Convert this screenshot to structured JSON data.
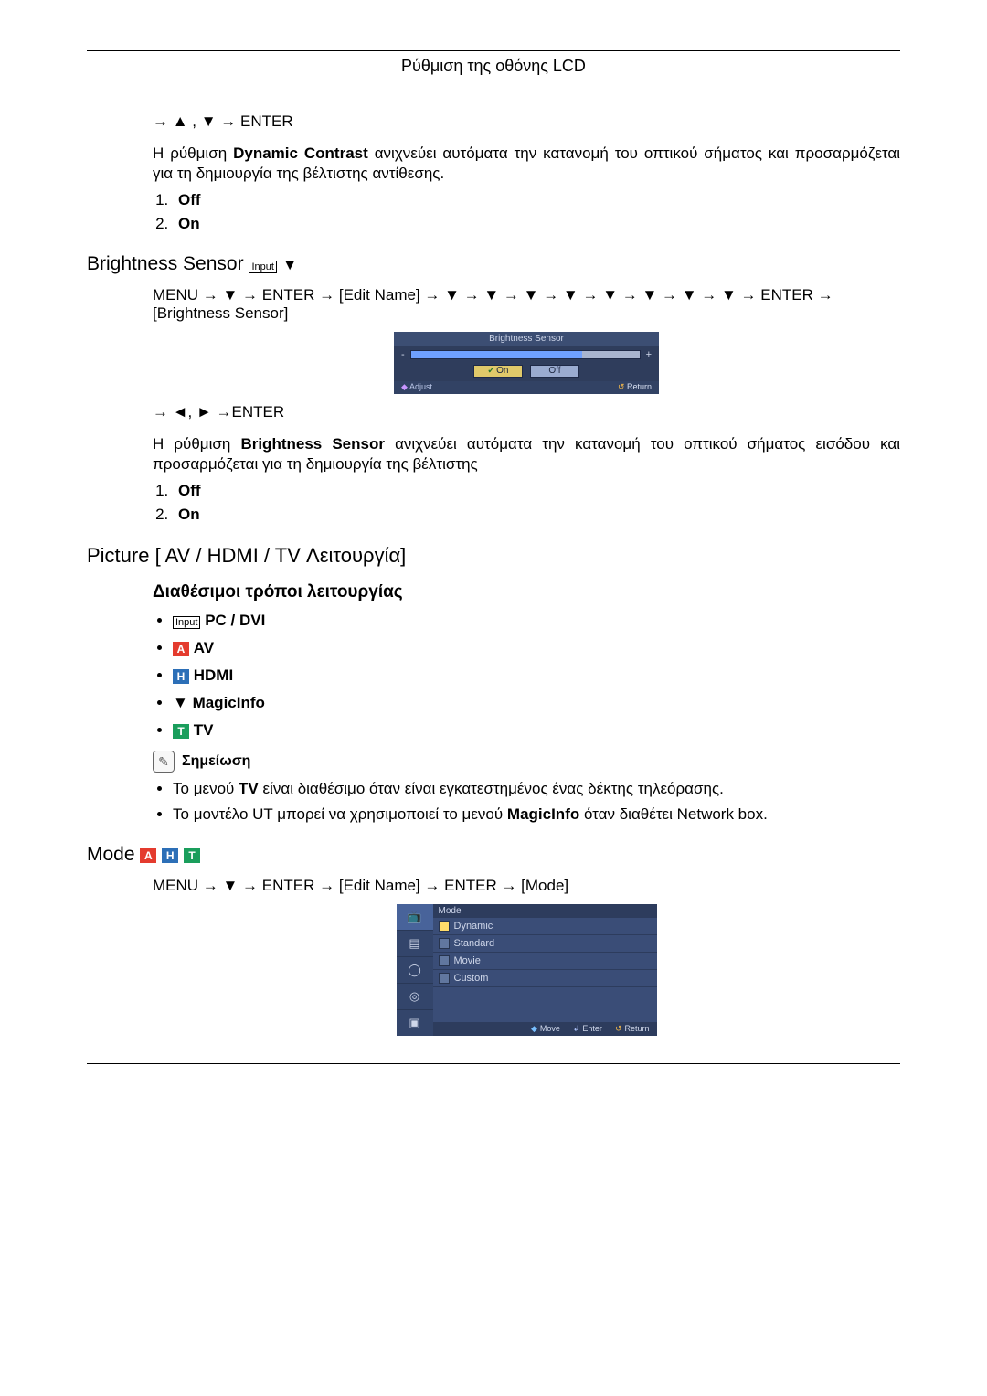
{
  "header": {
    "title": "Ρύθμιση της οθόνης LCD"
  },
  "dyn_contrast": {
    "nav": "→ ▲ , ▼ → ENTER",
    "desc_pre": "Η ρύθμιση ",
    "desc_bold": "Dynamic Contrast",
    "desc_post": " ανιχνεύει αυτόματα την κατανομή του οπτικού σήματος και προσαρμόζεται για τη δημιουργία της βέλτιστης αντίθεσης.",
    "opts": [
      "Off",
      "On"
    ]
  },
  "brightness_sensor": {
    "heading": "Brightness Sensor",
    "nav_line1_pre": "MENU → ▼ → ENTER → ",
    "nav_edit": "[Edit Name]",
    "nav_line1_mid": " → ▼ → ▼ → ▼ → ▼ → ▼ → ▼ → ▼ → ▼ → ENTER → ",
    "nav_label": "[Brightness Sensor]",
    "osd": {
      "title": "Brightness Sensor",
      "minus": "-",
      "plus": "+",
      "on": "On",
      "off": "Off",
      "adjust": "Adjust",
      "ret": "Return"
    },
    "nav2": "→ ◄, ► →ENTER",
    "desc_pre": "Η ρύθμιση ",
    "desc_bold": "Brightness Sensor",
    "desc_post": " ανιχνεύει αυτόματα την κατανομή του οπτικού σήματος εισόδου και προσαρμόζεται για τη δημιουργία της βέλτιστης",
    "opts": [
      "Off",
      "On"
    ]
  },
  "picture_av": {
    "heading": "Picture [ AV / HDMI / TV Λειτουργία]",
    "sub": "Διαθέσιμοι τρόποι λειτουργίας",
    "modes": {
      "pc": "PC / DVI",
      "av": "AV",
      "hdmi": "HDMI",
      "magic": "MagicInfo",
      "tv": "TV"
    },
    "note_label": "Σημείωση",
    "notes": [
      "Το μενού TV είναι διαθέσιμο όταν είναι εγκατεστημένος ένας δέκτης τηλεόρασης.",
      "Το μοντέλο UT μπορεί να χρησιμοποιεί το μενού MagicInfo όταν διαθέτει Network box."
    ],
    "notes_plain": {
      "n1_pre": "Το μενού ",
      "n1_bold": "TV",
      "n1_post": " είναι διαθέσιμο όταν είναι εγκατεστημένος ένας δέκτης τηλεόρασης.",
      "n2_pre": "Το μοντέλο UT μπορεί να χρησιμοποιεί το μενού ",
      "n2_bold": "MagicInfo",
      "n2_post": " όταν διαθέτει Network box."
    }
  },
  "mode": {
    "heading": "Mode",
    "nav_pre": "MENU → ▼ → ENTER → ",
    "nav_edit": "[Edit Name]",
    "nav_mid": " → ENTER → ",
    "nav_label": "[Mode]",
    "osd": {
      "title": "Mode",
      "items": [
        "Dynamic",
        "Standard",
        "Movie",
        "Custom"
      ],
      "move": "Move",
      "enter": "Enter",
      "ret": "Return"
    }
  },
  "icons": {
    "a": "A",
    "h": "H",
    "t": "T",
    "m": "▼",
    "input": "Input",
    "note": "✎",
    "tick": "✔"
  }
}
